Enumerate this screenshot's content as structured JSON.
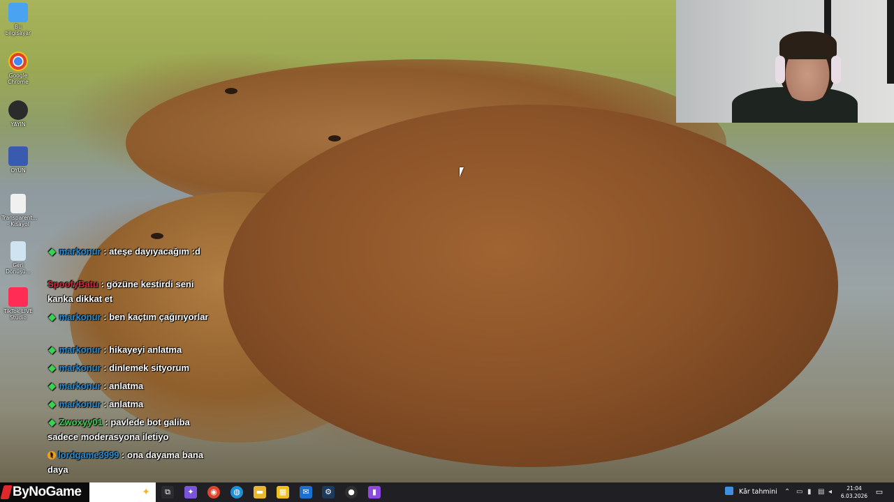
{
  "desktop": {
    "icons": [
      {
        "label": "Bu bilgisayar",
        "icon": "computer-icon",
        "color": "#4aa3f0"
      },
      {
        "label": "Google Chrome",
        "icon": "chrome-icon",
        "color": "#e0442f"
      },
      {
        "label": "YAYIN",
        "icon": "obs-icon",
        "color": "#2b2b2b"
      },
      {
        "label": "OYUN",
        "icon": "game-shortcut-icon",
        "color": "#3a5ab0"
      },
      {
        "label": "Transparent... - Kısayol",
        "icon": "file-shortcut-icon",
        "color": "#f0f0f0"
      },
      {
        "label": "Geri Dönüşü...",
        "icon": "recycle-bin-icon",
        "color": "#cfe3f0"
      },
      {
        "label": "TikTok LIVE Studio",
        "icon": "tiktok-icon",
        "color": "#ff2d55"
      }
    ]
  },
  "chat": {
    "user_color": "#2a8fd6",
    "messages": [
      {
        "badge": "diamond",
        "user": "markonur",
        "text": "ateşe dayıyacağım :d"
      },
      {
        "badge": "none",
        "user": "SpoofyBatu",
        "user_color": "#d2283c",
        "text": "gözüne kestirdi seni kanka dikkat et"
      },
      {
        "badge": "diamond",
        "user": "markonur",
        "text": "ben kaçtım çağırıyorlar"
      },
      {
        "badge": "diamond",
        "user": "markonur",
        "text": "hikayeyi anlatma"
      },
      {
        "badge": "diamond",
        "user": "markonur",
        "text": "dinlemek sityorum"
      },
      {
        "badge": "diamond",
        "user": "markonur",
        "text": "anlatma"
      },
      {
        "badge": "diamond",
        "user": "markonur",
        "text": "anlatma"
      },
      {
        "badge": "diamond",
        "user": "Zwoxyy01",
        "user_color": "#39d353",
        "text": "pavlede bot galiba sadece moderasyona iletiyo"
      },
      {
        "badge": "warn",
        "user": "lordgame3999",
        "text": "ona dayama bana daya"
      }
    ]
  },
  "taskbar": {
    "brand": "ByNoGame",
    "search_icon": "copilot-spark-icon",
    "apps": [
      {
        "name": "task-view-icon",
        "glyph": "⧉",
        "color": "#2b2b30"
      },
      {
        "name": "copilot-icon",
        "glyph": "✦",
        "color": "#7a55d8"
      },
      {
        "name": "chrome-icon",
        "glyph": "◉",
        "color": "#e0442f"
      },
      {
        "name": "edge-icon",
        "glyph": "◍",
        "color": "#1f8fd6"
      },
      {
        "name": "file-explorer-icon",
        "glyph": "▬",
        "color": "#e8b830"
      },
      {
        "name": "microsoft-store-icon",
        "glyph": "▦",
        "color": "#f0c020"
      },
      {
        "name": "outlook-icon",
        "glyph": "✉",
        "color": "#1a6fd0"
      },
      {
        "name": "steam-icon",
        "glyph": "⚙",
        "color": "#1b3a5c"
      },
      {
        "name": "obs-icon",
        "glyph": "●",
        "color": "#303030"
      },
      {
        "name": "twitch-icon",
        "glyph": "▮",
        "color": "#8e4ae0"
      }
    ],
    "weather": "Kâr tahmini",
    "tray_icons": [
      "chevron-up-icon",
      "usb-icon",
      "microphone-icon",
      "network-icon",
      "speaker-icon",
      "battery-icon"
    ],
    "time": "21:04",
    "date": "6.03.2026"
  }
}
